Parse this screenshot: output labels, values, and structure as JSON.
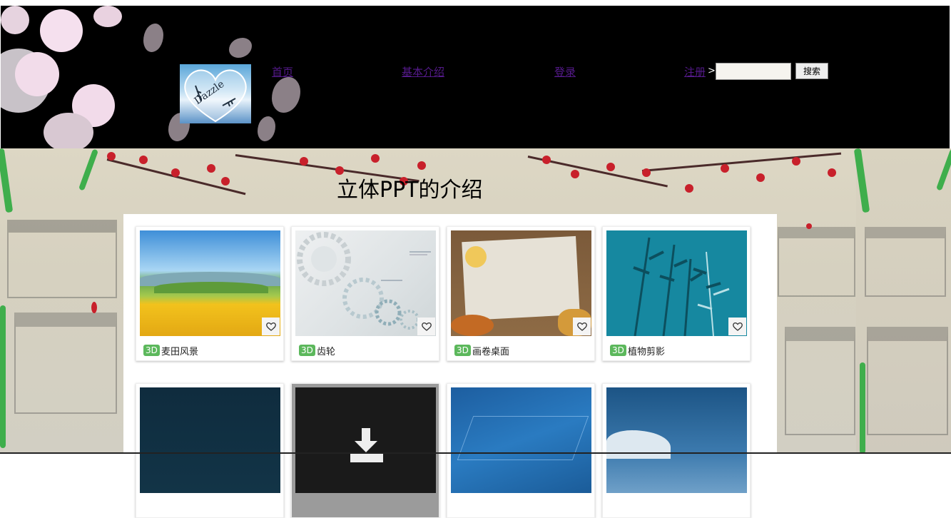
{
  "header": {
    "logo_alt": "Dazzle",
    "nav": [
      {
        "label": "首页"
      },
      {
        "label": "基本介绍"
      },
      {
        "label": "登录"
      },
      {
        "label": "注册"
      }
    ],
    "separator": ">",
    "search": {
      "value": "",
      "placeholder": ""
    },
    "search_button": "搜索"
  },
  "main": {
    "title": "立体PPT的介绍",
    "cards": [
      {
        "tag": "3D",
        "name": "麦田风景"
      },
      {
        "tag": "3D",
        "name": "齿轮"
      },
      {
        "tag": "3D",
        "name": "画卷桌面"
      },
      {
        "tag": "3D",
        "name": "植物剪影"
      },
      {
        "tag": "",
        "name": ""
      },
      {
        "tag": "",
        "name": ""
      },
      {
        "tag": "",
        "name": ""
      },
      {
        "tag": "",
        "name": ""
      }
    ]
  },
  "colors": {
    "header_bg": "#000000",
    "link": "#551a8b",
    "badge": "#5cb85c",
    "blossom_pink": "#f1d6e8",
    "plum_red": "#c8202b"
  },
  "icons": {
    "heart": "heart-outline-icon",
    "download": "download-icon"
  }
}
